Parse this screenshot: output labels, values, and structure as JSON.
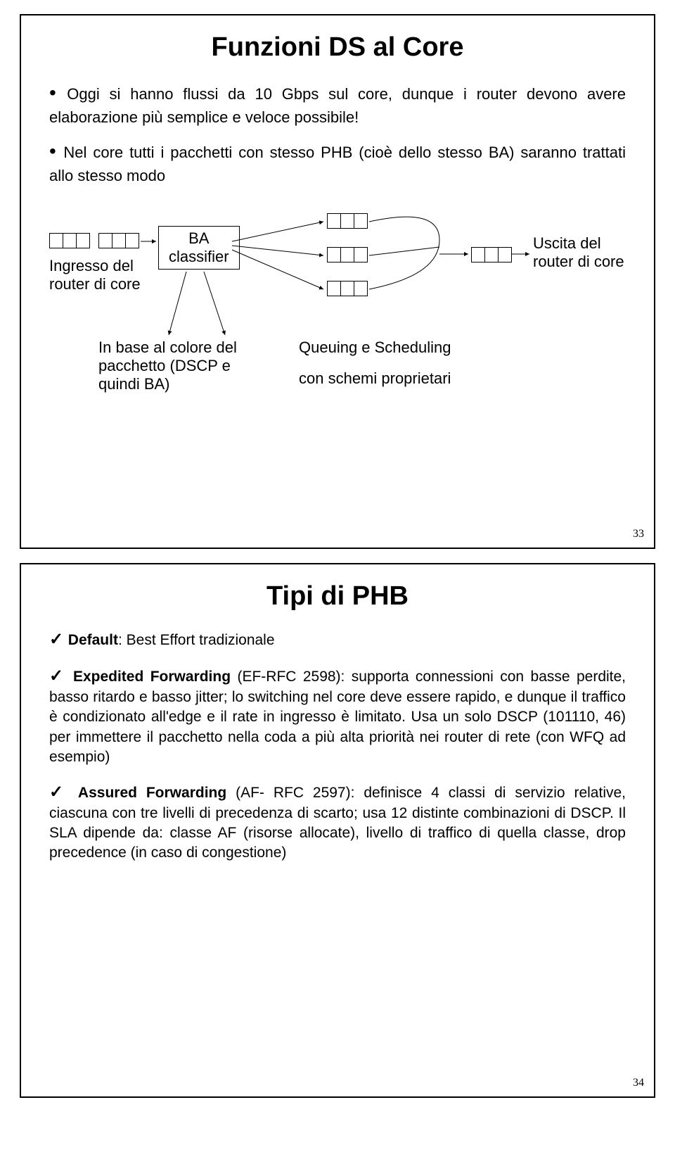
{
  "slide1": {
    "title": "Funzioni DS al Core",
    "bullet1": "Oggi si hanno flussi da 10 Gbps sul core, dunque i router devono avere elaborazione più semplice e veloce possibile!",
    "bullet2": "Nel core tutti i pacchetti con stesso PHB (cioè dello stesso BA) saranno trattati allo stesso modo",
    "diagram": {
      "ingresso_l1": "Ingresso del",
      "ingresso_l2": "router di core",
      "ba_l1": "BA",
      "ba_l2": "classifier",
      "base_l1": "In base al colore del",
      "base_l2": "pacchetto (DSCP e",
      "base_l3": "quindi BA)",
      "uscita_l1": "Uscita del",
      "uscita_l2": "router di core",
      "queuing": "Queuing e Scheduling",
      "schemi": "con schemi proprietari"
    },
    "page": "33"
  },
  "slide2": {
    "title": "Tipi di PHB",
    "item1_lead": "Default",
    "item1_rest": ": Best Effort tradizionale",
    "item2_lead": "Expedited Forwarding",
    "item2_rest": " (EF-RFC 2598): supporta connessioni con basse perdite, basso ritardo e basso jitter; lo switching nel core deve essere rapido, e dunque il traffico è condizionato all'edge e il rate in ingresso è limitato. Usa un solo DSCP (101110, 46) per immettere il pacchetto nella coda a più alta priorità nei router di rete (con WFQ ad esempio)",
    "item3_lead": "Assured Forwarding",
    "item3_rest": " (AF- RFC 2597): definisce 4 classi di servizio relative, ciascuna con tre livelli di precedenza di scarto; usa 12 distinte combinazioni di DSCP. Il SLA dipende da: classe AF (risorse allocate), livello di traffico di quella classe, drop precedence (in caso di congestione)",
    "page": "34"
  }
}
